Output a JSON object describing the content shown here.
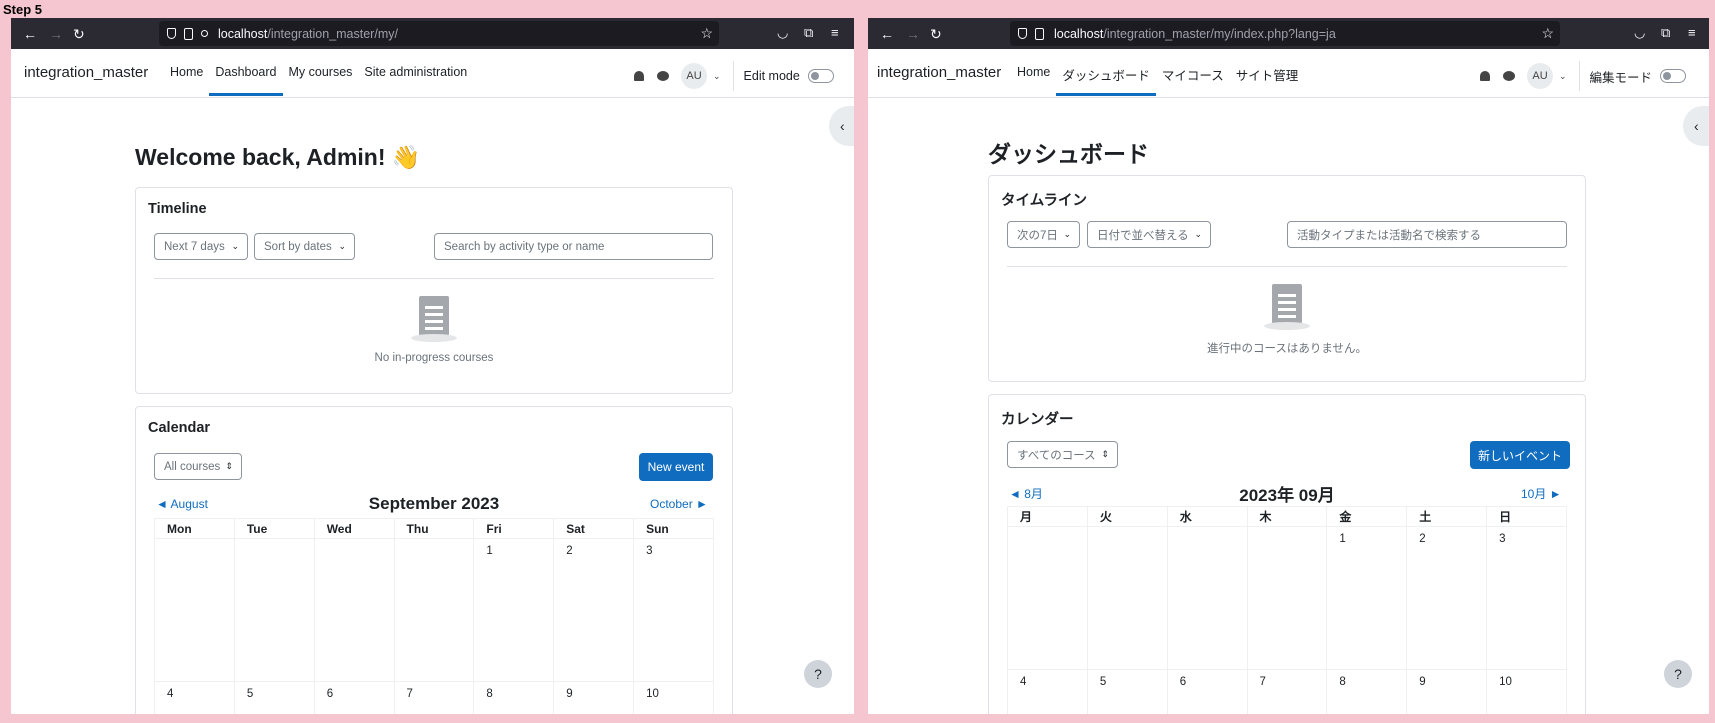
{
  "step_label": "Step 5",
  "left": {
    "url": {
      "host": "localhost",
      "path": "/integration_master/my/"
    },
    "brand": "integration_master",
    "nav": [
      "Home",
      "Dashboard",
      "My courses",
      "Site administration"
    ],
    "avatar": "AU",
    "edit_mode": "Edit mode",
    "page_title": "Welcome back, Admin! 👋",
    "timeline": {
      "title": "Timeline",
      "filter_days": "Next 7 days",
      "sort": "Sort by dates",
      "search_placeholder": "Search by activity type or name",
      "empty": "No in-progress courses"
    },
    "calendar": {
      "title": "Calendar",
      "course_select": "All courses",
      "new_event": "New event",
      "prev": "◄  August",
      "next": "October  ►",
      "month": "September 2023",
      "days": [
        "Mon",
        "Tue",
        "Wed",
        "Thu",
        "Fri",
        "Sat",
        "Sun"
      ],
      "weeks": [
        [
          "",
          "",
          "",
          "",
          "1",
          "2",
          "3"
        ],
        [
          "4",
          "5",
          "6",
          "7",
          "8",
          "9",
          "10"
        ]
      ]
    },
    "help": "?"
  },
  "right": {
    "url": {
      "host": "localhost",
      "path": "/integration_master/my/index.php?lang=ja"
    },
    "brand": "integration_master",
    "nav": [
      "Home",
      "ダッシュボード",
      "マイコース",
      "サイト管理"
    ],
    "avatar": "AU",
    "edit_mode": "編集モード",
    "page_title": "ダッシュボード",
    "timeline": {
      "title": "タイムライン",
      "filter_days": "次の7日",
      "sort": "日付で並べ替える",
      "search_placeholder": "活動タイプまたは活動名で検索する",
      "empty": "進行中のコースはありません。"
    },
    "calendar": {
      "title": "カレンダー",
      "course_select": "すべてのコース",
      "new_event": "新しいイベント",
      "prev": "◄  8月",
      "next": "10月  ►",
      "month": "2023年 09月",
      "days": [
        "月",
        "火",
        "水",
        "木",
        "金",
        "土",
        "日"
      ],
      "weeks": [
        [
          "",
          "",
          "",
          "",
          "1",
          "2",
          "3"
        ],
        [
          "4",
          "5",
          "6",
          "7",
          "8",
          "9",
          "10"
        ]
      ]
    },
    "help": "?"
  }
}
